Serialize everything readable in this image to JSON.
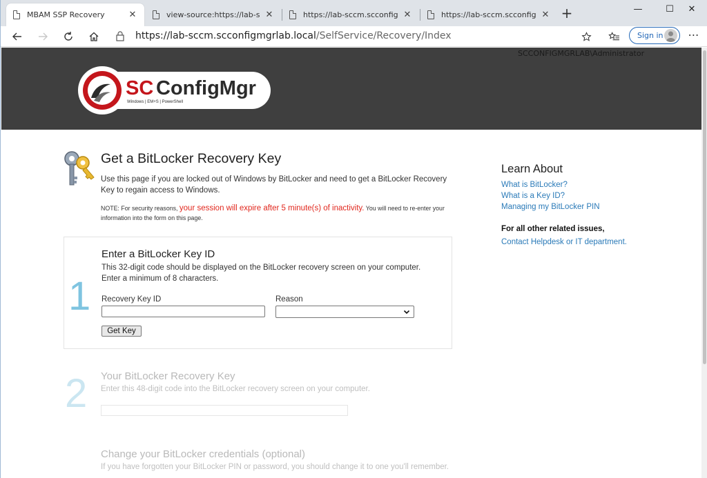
{
  "browser": {
    "tabs": [
      {
        "title": "MBAM SSP Recovery",
        "active": true
      },
      {
        "title": "view-source:https://lab-sccm.scc",
        "active": false
      },
      {
        "title": "https://lab-sccm.scconfigmgrlab",
        "active": false
      },
      {
        "title": "https://lab-sccm.scconfigmgrlab",
        "active": false
      }
    ],
    "new_tab_glyph": "+",
    "window_controls": {
      "minimize": "—",
      "maximize": "☐",
      "close": "✕"
    },
    "address": {
      "host": "https://lab-sccm.scconfigmgrlab.local",
      "path": "/SelfService/Recovery/Index"
    },
    "sign_in_label": "Sign in",
    "more_glyph": "⋯",
    "icons": [
      "back-icon",
      "forward-icon",
      "refresh-icon",
      "home-icon",
      "lock-icon",
      "star-icon",
      "favorites-icon",
      "avatar-icon"
    ]
  },
  "header": {
    "username": "SCCONFIGMGRLAB\\Administrator",
    "logo": {
      "name": "SCConfigMgr",
      "tagline": "Windows | EM+S | PowerShell",
      "colors": {
        "red": "#c4161c",
        "dark": "#2b2b2b"
      }
    }
  },
  "main": {
    "title": "Get a BitLocker Recovery Key",
    "intro": "Use this page if you are locked out of Windows by BitLocker and need to get a BitLocker Recovery Key to regain access to Windows.",
    "note_prefix": "NOTE: For security reasons, ",
    "note_warning": "your session will expire after 5 minute(s) of inactivity.",
    "note_suffix": " You will need to re-enter your information into the form on this page.",
    "warning_color": "#e1261c",
    "step1": {
      "number": "1",
      "title": "Enter a BitLocker Key ID",
      "description": "This 32-digit code should be displayed on the BitLocker recovery screen on your computer. Enter a minimum of 8 characters.",
      "key_label": "Recovery Key ID",
      "key_value": "",
      "reason_label": "Reason",
      "reason_value": "",
      "button_label": "Get Key"
    },
    "step2": {
      "number": "2",
      "title": "Your BitLocker Recovery Key",
      "description": "Enter this 48-digit code into the BitLocker recovery screen on your computer."
    },
    "step3": {
      "title": "Change your BitLocker credentials (optional)",
      "description": "If you have forgotten your BitLocker PIN or password, you should change it to one you'll remember."
    }
  },
  "sidebar": {
    "title": "Learn About",
    "links": [
      "What is BitLocker?",
      "What is a Key ID?",
      "Managing my BitLocker PIN"
    ],
    "other_title": "For all other related issues,",
    "other_link": "Contact Helpdesk or IT department.",
    "link_color": "#2a7ab8"
  }
}
